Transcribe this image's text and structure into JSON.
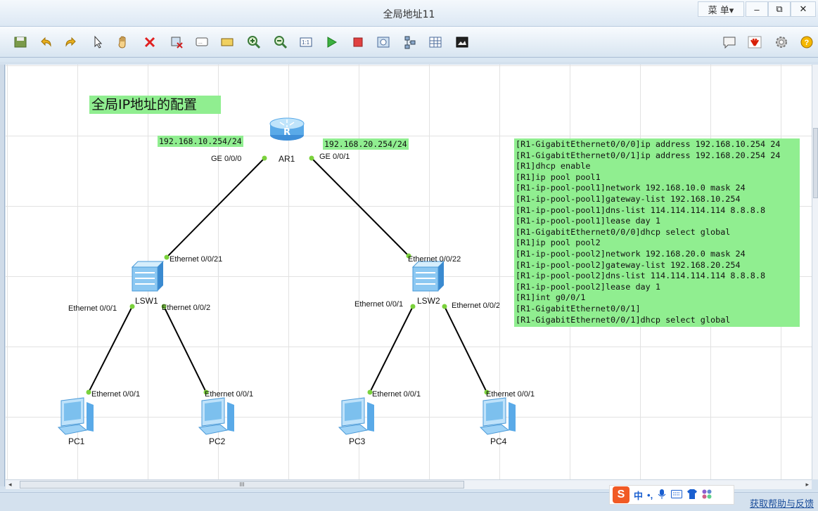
{
  "window": {
    "title": "全局地址11",
    "menu_label": "菜 单▾",
    "minimize": "–",
    "restore": "⧉",
    "close": "✕"
  },
  "toolbar": {
    "items": [
      "save-icon",
      "undo-icon",
      "redo-icon",
      "select-icon",
      "hand-icon",
      "delete-icon",
      "erase-icon",
      "text-icon",
      "rect-icon",
      "zoom-in-icon",
      "zoom-out-icon",
      "fit-icon",
      "start-icon",
      "stop-icon",
      "capture-icon",
      "topology-icon",
      "grid-icon",
      "screenshot-icon"
    ],
    "right_items": [
      "chat-icon",
      "huawei-icon",
      "settings-icon",
      "help-icon"
    ]
  },
  "canvas": {
    "heading": "全局IP地址的配置",
    "ip_left": "192.168.10.254/24",
    "ip_right": "192.168.20.254/24",
    "router": {
      "name": "AR1",
      "port_left": "GE 0/0/0",
      "port_right": "GE 0/0/1"
    },
    "switches": [
      {
        "name": "LSW1",
        "uplink": "Ethernet 0/0/21",
        "port_a": "Ethernet 0/0/1",
        "port_b": "Ethernet 0/0/2"
      },
      {
        "name": "LSW2",
        "uplink": "Ethernet 0/0/22",
        "port_a": "Ethernet 0/0/1",
        "port_b": "Ethernet 0/0/2"
      }
    ],
    "pcs": [
      {
        "name": "PC1",
        "port": "Ethernet 0/0/1"
      },
      {
        "name": "PC2",
        "port": "Ethernet 0/0/1"
      },
      {
        "name": "PC3",
        "port": "Ethernet 0/0/1"
      },
      {
        "name": "PC4",
        "port": "Ethernet 0/0/1"
      }
    ],
    "cli_lines": [
      "[R1-GigabitEthernet0/0/0]ip address 192.168.10.254 24",
      "[R1-GigabitEthernet0/0/1]ip address 192.168.20.254 24",
      "[R1]dhcp enable",
      "[R1]ip pool pool1",
      "[R1-ip-pool-pool1]network 192.168.10.0 mask 24",
      "[R1-ip-pool-pool1]gateway-list 192.168.10.254",
      "[R1-ip-pool-pool1]dns-list 114.114.114.114 8.8.8.8",
      "[R1-ip-pool-pool1]lease day 1",
      "[R1-GigabitEthernet0/0/0]dhcp select global",
      "[R1]ip pool pool2",
      "[R1-ip-pool-pool2]network 192.168.20.0 mask 24",
      "[R1-ip-pool-pool2]gateway-list 192.168.20.254",
      "[R1-ip-pool-pool2]dns-list 114.114.114.114 8.8.8.8",
      "[R1-ip-pool-pool2]lease day 1",
      "[R1]int g0/0/1",
      "[R1-GigabitEthernet0/0/1]",
      "[R1-GigabitEthernet0/0/1]dhcp select global"
    ],
    "link_color": "#000000",
    "port_dot_color": "#7bd23c",
    "label_bg": "#90ee90"
  },
  "scrollbar": {
    "grip": "III"
  },
  "ime": {
    "lang": "中",
    "punct": "•,"
  },
  "status": {
    "feedback": "获取帮助与反馈"
  }
}
